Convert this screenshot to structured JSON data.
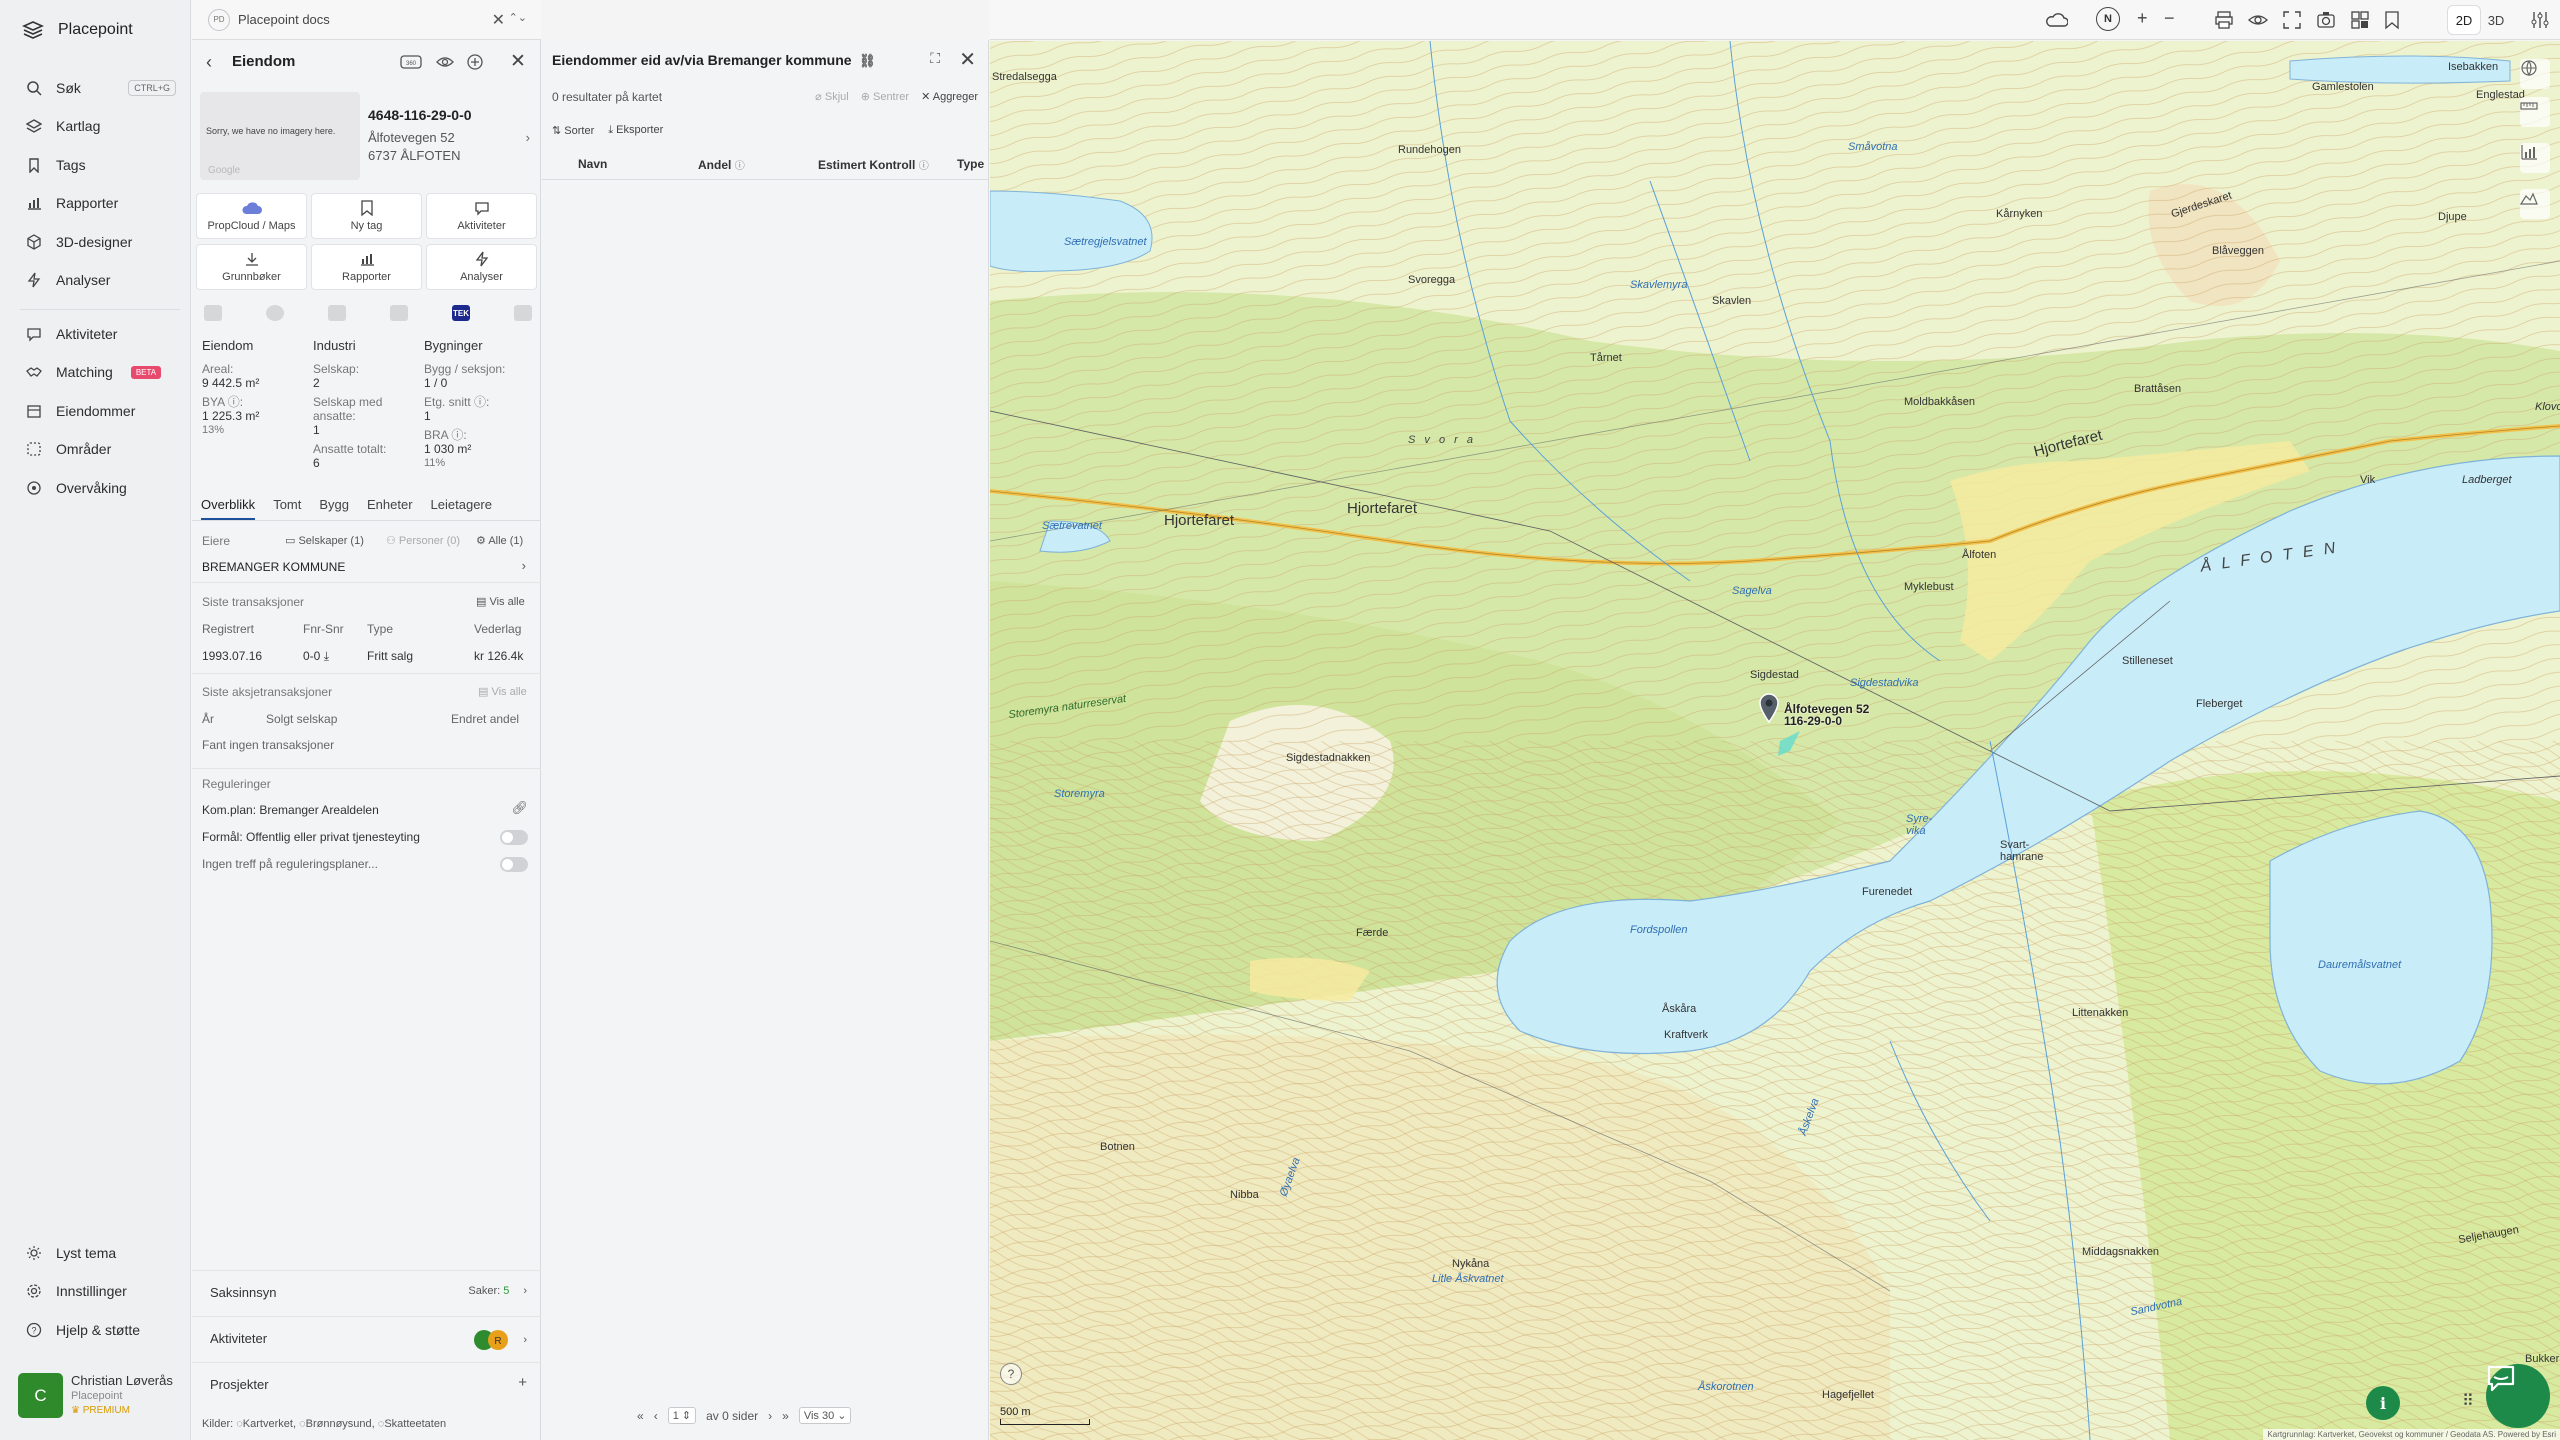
{
  "app": {
    "brand": "Placepoint",
    "search_shortcut": "CTRL+G",
    "nav": [
      {
        "label": "Søk",
        "icon": "search-icon"
      },
      {
        "label": "Kartlag",
        "icon": "layers-icon"
      },
      {
        "label": "Tags",
        "icon": "bookmark-icon"
      },
      {
        "label": "Rapporter",
        "icon": "chart-icon"
      },
      {
        "label": "3D-designer",
        "icon": "cube-icon"
      },
      {
        "label": "Analyser",
        "icon": "bolt-icon"
      }
    ],
    "nav2": [
      {
        "label": "Aktiviteter",
        "icon": "chat-icon"
      },
      {
        "label": "Matching",
        "icon": "handshake-icon",
        "badge": "BETA"
      },
      {
        "label": "Eiendommer",
        "icon": "building-icon"
      },
      {
        "label": "Områder",
        "icon": "area-icon"
      },
      {
        "label": "Overvåking",
        "icon": "radar-icon"
      }
    ],
    "bottom_nav": [
      {
        "label": "Lyst tema",
        "icon": "sun-icon"
      },
      {
        "label": "Innstillinger",
        "icon": "gear-icon"
      },
      {
        "label": "Hjelp & støtte",
        "icon": "help-icon"
      }
    ],
    "user": {
      "initial": "C",
      "name": "Christian Løverås",
      "org": "Placepoint",
      "plan": "PREMIUM"
    }
  },
  "doc_tab": {
    "badge": "PD",
    "title": "Placepoint docs"
  },
  "property": {
    "header": "Eiendom",
    "imagery_text": "Sorry, we have no imagery here.",
    "imagery_credit": "Google",
    "id": "4648-116-29-0-0",
    "address_line1": "Ålfotevegen 52",
    "address_line2": "6737 ÅLFOTEN",
    "actions": [
      {
        "label": "PropCloud / Maps",
        "icon": "cloud-icon"
      },
      {
        "label": "Ny tag",
        "icon": "bookmark-icon"
      },
      {
        "label": "Aktiviteter",
        "icon": "chat-icon"
      },
      {
        "label": "Grunnbøker",
        "icon": "download-icon"
      },
      {
        "label": "Rapporter",
        "icon": "chart-icon"
      },
      {
        "label": "Analyser",
        "icon": "bolt-icon"
      }
    ],
    "tek_badge": "TEK",
    "stats": {
      "eiendom": {
        "heading": "Eiendom",
        "areal_label": "Areal:",
        "areal_value": "9 442.5 m²",
        "bya_label": "BYA ⓘ:",
        "bya_value": "1 225.3 m²",
        "bya_pct": "13%"
      },
      "industri": {
        "heading": "Industri",
        "selskap_label": "Selskap:",
        "selskap_value": "2",
        "ansatte_label": "Selskap med ansatte:",
        "ansatte_value": "1",
        "totalt_label": "Ansatte totalt:",
        "totalt_value": "6"
      },
      "bygninger": {
        "heading": "Bygninger",
        "bygg_label": "Bygg / seksjon:",
        "bygg_value": "1 / 0",
        "etg_label": "Etg. snitt ⓘ:",
        "etg_value": "1",
        "bra_label": "BRA ⓘ:",
        "bra_value": "1 030 m²",
        "bra_pct": "11%"
      }
    },
    "tabs": [
      "Overblikk",
      "Tomt",
      "Bygg",
      "Enheter",
      "Leietagere"
    ],
    "owners_label": "Eiere",
    "owner_filters": {
      "selskaper": "Selskaper (1)",
      "personer": "Personer (0)",
      "alle": "Alle (1)"
    },
    "owner_name": "BREMANGER KOMMUNE",
    "transactions": {
      "label": "Siste transaksjoner",
      "show_all": "Vis alle",
      "cols": [
        "Registrert",
        "Fnr-Snr",
        "Type",
        "Vederlag"
      ],
      "row": {
        "registrert": "1993.07.16",
        "fnr": "0-0",
        "type": "Fritt salg",
        "vederlag": "kr 126.4k"
      }
    },
    "share_tx": {
      "label": "Siste aksjetransaksjoner",
      "show_all": "Vis alle",
      "cols": [
        "År",
        "Solgt selskap",
        "Endret andel"
      ],
      "empty": "Fant ingen transaksjoner"
    },
    "regulations": {
      "label": "Reguleringer",
      "plan": "Kom.plan: Bremanger Arealdelen",
      "formal": "Formål: Offentlig eller privat tjenesteyting",
      "none": "Ingen treff på reguleringsplaner..."
    },
    "accordions": {
      "saksinnsyn": "Saksinnsyn",
      "saker_label": "Saker:",
      "saker_count": "5",
      "aktiviteter": "Aktiviteter",
      "prosjekter": "Prosjekter"
    },
    "sources_label": "Kilder:",
    "sources": [
      "Kartverket",
      "Brønnøysund",
      "Skatteetaten"
    ]
  },
  "table_panel": {
    "title": "Eiendommer eid av/via Bremanger kommune",
    "count_text": "0 resultater på kartet",
    "actions": {
      "skjul": "Skjul",
      "sentrer": "Sentrer",
      "aggreger": "Aggreger"
    },
    "tools": {
      "sorter": "Sorter",
      "eksporter": "Eksporter"
    },
    "columns": [
      "Navn",
      "Andel",
      "Estimert Kontroll",
      "Type"
    ],
    "pager": {
      "page": "1",
      "of_text": "av 0 sider",
      "per_page": "Vis 30"
    }
  },
  "map_toolbar": {
    "north": "N",
    "plus": "+",
    "minus": "−",
    "view_2d": "2D",
    "view_3d": "3D"
  },
  "map": {
    "scale": "500 m",
    "attribution": "Kartgrunnlag: Kartverket, Geovekst og kommuner / Geodata AS. Powered by Esri",
    "marker_label_1": "Ålfotevegen 52",
    "marker_label_2": "116-29-0-0",
    "labels": {
      "gamlestolen": "Gamlestolen",
      "isebakken": "Isebakken",
      "englestad": "Englestad",
      "stredalsegga": "Stredalsegga",
      "rundehogen": "Rundehogen",
      "smavotna": "Småvotna",
      "karnyken": "Kårnyken",
      "gjerdeskaret": "Gjerdeskaret",
      "djupe": "Djupe",
      "blaveggen": "Blåveggen",
      "svoregga": "Svoregga",
      "skavlemyra": "Skavlemyra",
      "skavlen": "Skavlen",
      "saetregjelsvatnet": "Sætregjelsvatnet",
      "tarnet": "Tårnet",
      "moldbakkasen": "Moldbakkåsen",
      "brattasen": "Brattåsen",
      "svora": "S v o r a",
      "hjortefaret_e": "Hjortefaret",
      "hjortefaret_w": "Hjortefaret",
      "hjortefaret_m": "Hjortefaret",
      "vik": "Vik",
      "ladberget": "Ladberget",
      "saetrevatnet": "Sætrevatnet",
      "alfoten_town": "Ålfoten",
      "alfoten_lake": "Å L F O T E N",
      "sagelva": "Sagelva",
      "myklebust": "Myklebust",
      "stilleneset": "Stilleneset",
      "sigdestad": "Sigdestad",
      "sigdestadvika": "Sigdestadvika",
      "storemyra_nr": "Storemyra naturreservat",
      "fleberget": "Fleberget",
      "sigdestadnakken": "Sigdestadnakken",
      "storemyra": "Storemyra",
      "syrevika": "Syre-vika",
      "svarthamrane": "Svart-hamrane",
      "furenedet": "Furenedet",
      "fordspollen": "Fordspollen",
      "daurematsvatnet": "Dauremålsvatnet",
      "faerde": "Færde",
      "askara": "Åskåra",
      "kraftverk": "Kraftverk",
      "litlenakken": "Littenakken",
      "botnen": "Botnen",
      "nibba": "Nibba",
      "askelva": "Åskelva",
      "oyaelva": "Øyaelva",
      "middagsnakken": "Middagsnakken",
      "nykana": "Nykåna",
      "litle_askvatnet": "Litle Åskvatnet",
      "sandvotna": "Sandvotna",
      "hagefjellet": "Hagefjellet",
      "askorotnen": "Åskorotnen",
      "bukker": "Bukker",
      "klovo": "Klovo",
      "seljehaugen": "Seljehaugen"
    }
  }
}
